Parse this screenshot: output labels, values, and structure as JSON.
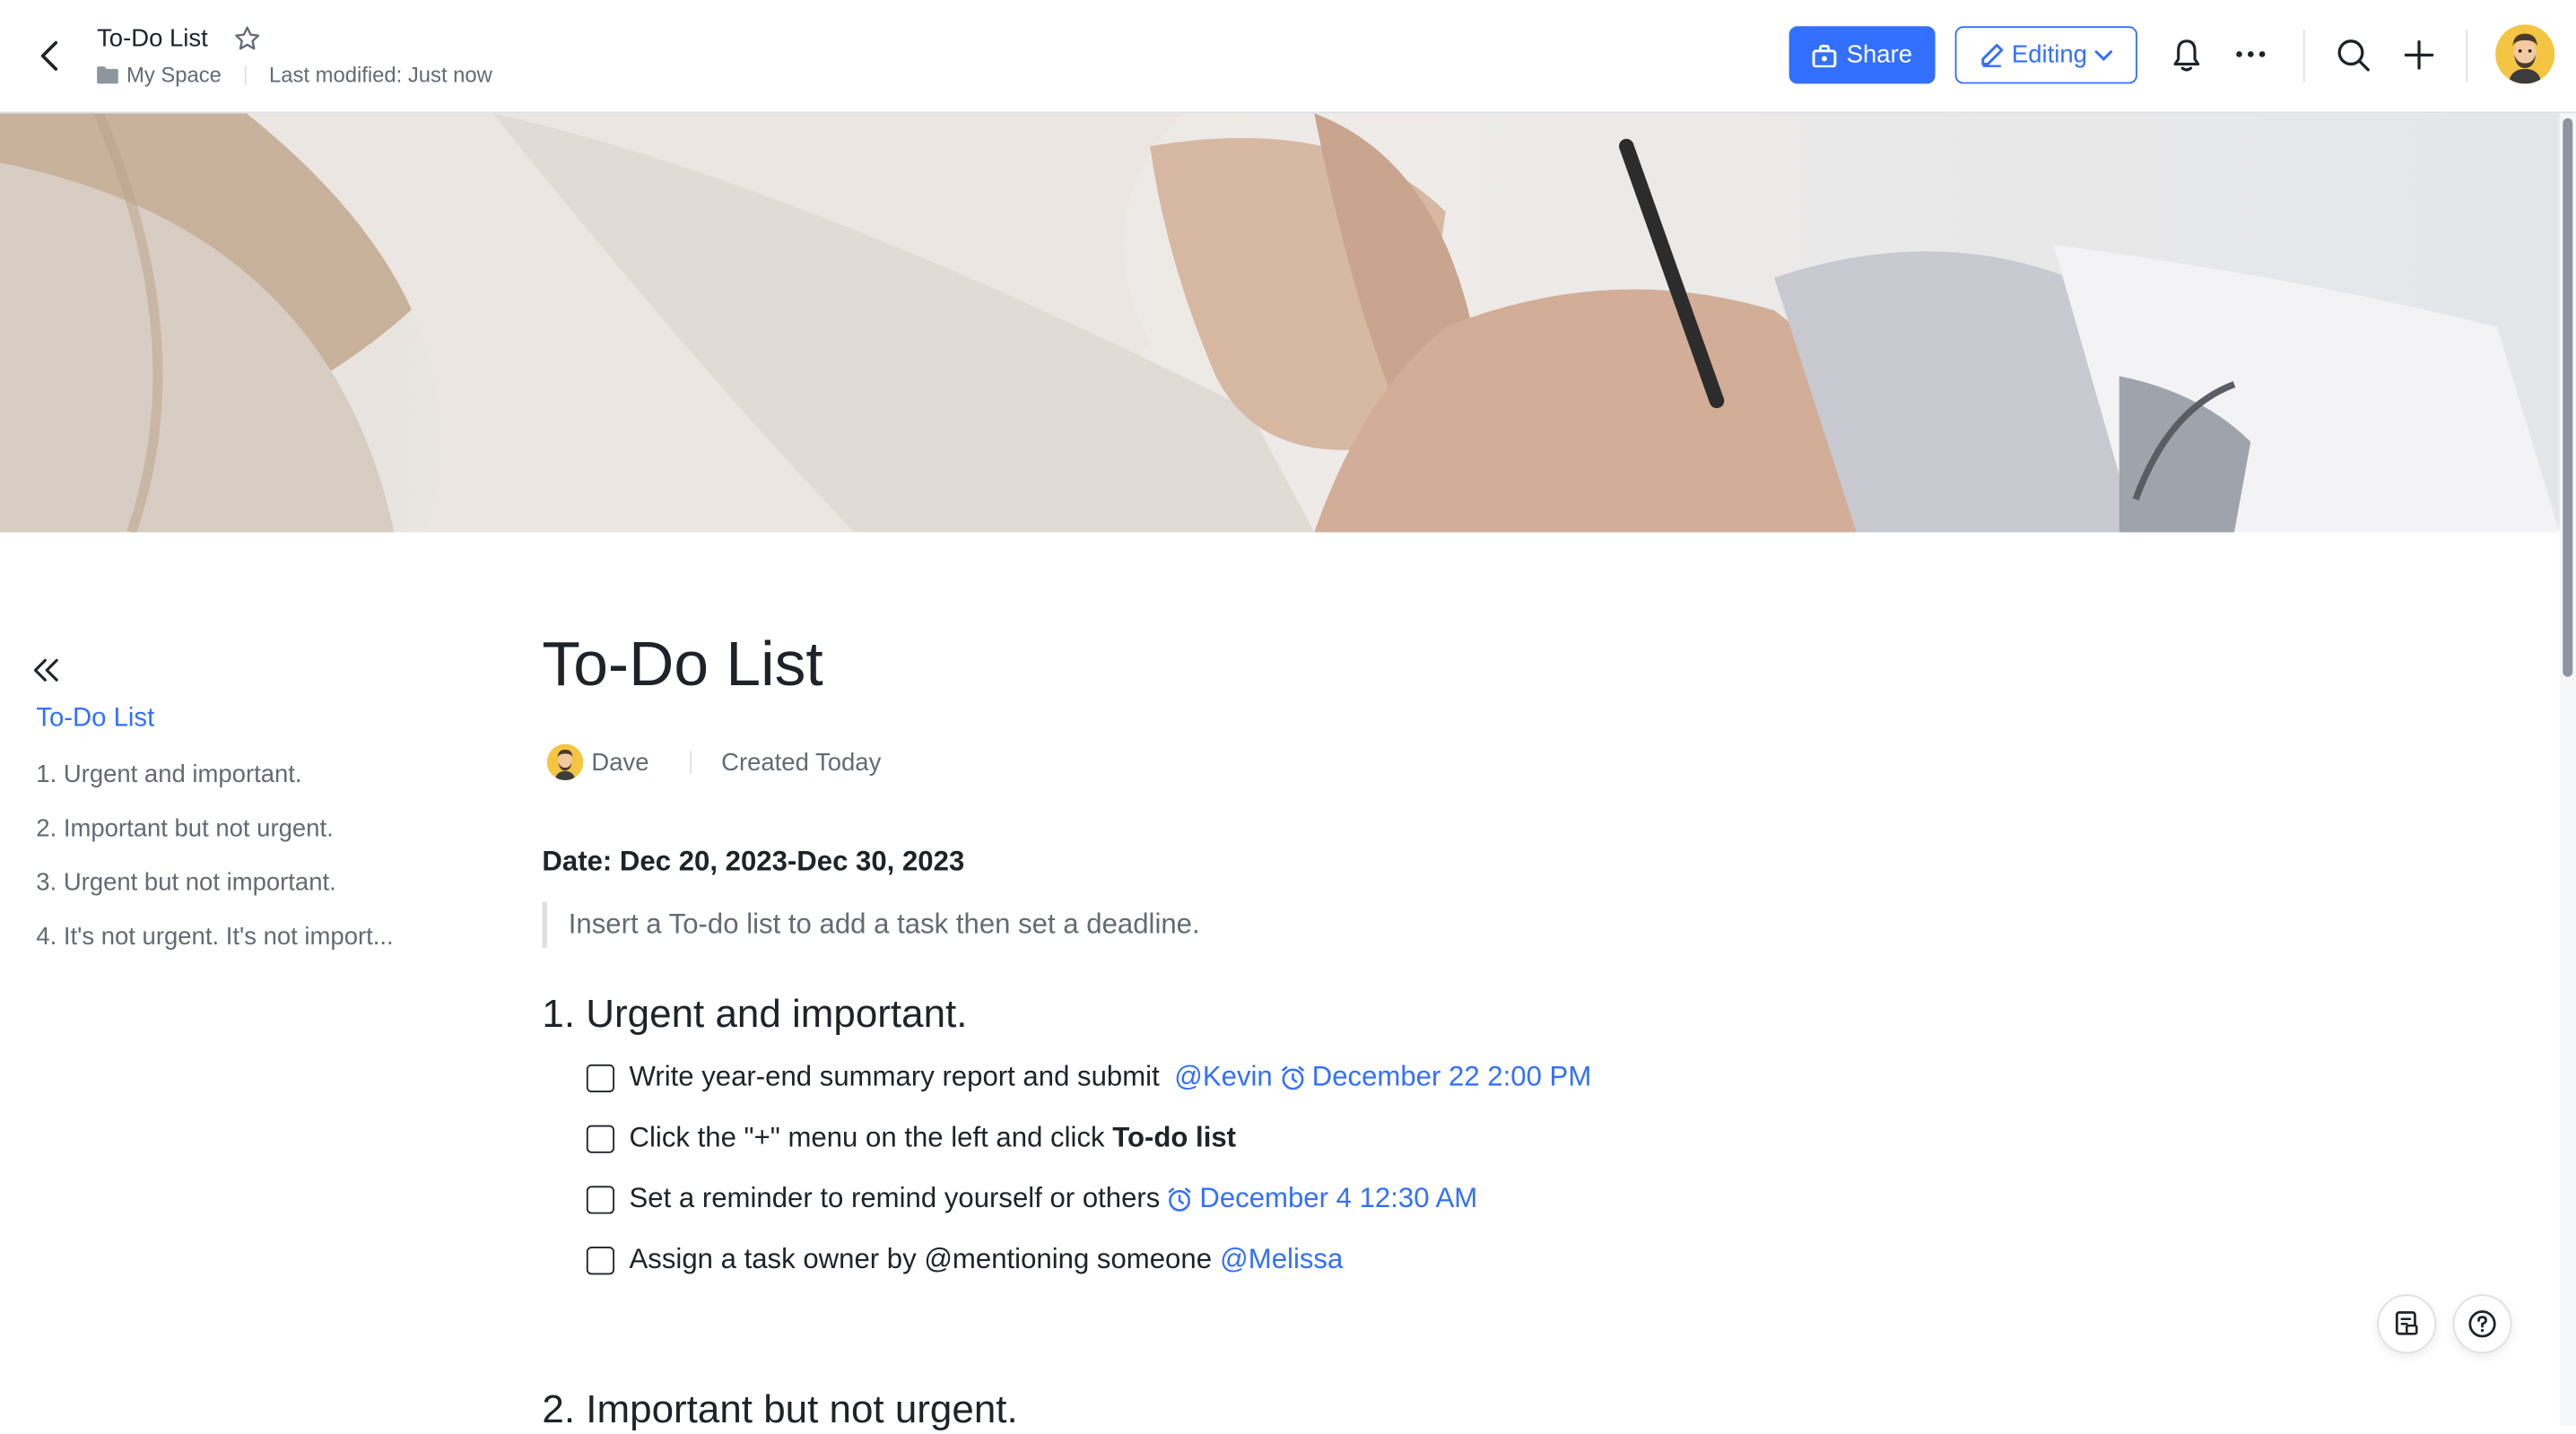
{
  "header": {
    "doc_title": "To-Do List",
    "location": "My Space",
    "last_modified": "Last modified: Just now",
    "share_label": "Share",
    "editing_label": "Editing",
    "accent": "#3370ff"
  },
  "toc": {
    "items": [
      {
        "label": "To-Do List"
      },
      {
        "label": "1. Urgent and important."
      },
      {
        "label": "2. Important but not urgent."
      },
      {
        "label": "3. Urgent but not important."
      },
      {
        "label": "4. It's not urgent. It's not import..."
      }
    ]
  },
  "doc": {
    "title": "To-Do List",
    "author": "Dave",
    "created": "Created Today",
    "date_line": "Date: Dec 20, 2023-Dec 30, 2023",
    "quote": "Insert a To-do list to add a task then set a deadline.",
    "section1": "1. Urgent and important.",
    "section2": "2. Important but not urgent.",
    "todos": [
      {
        "text": "Write year-end summary report and submit",
        "mention": "@Kevin",
        "reminder": "December 22 2:00 PM"
      },
      {
        "text": "Click the \"+\" menu on the left and click ",
        "bold": "To-do list"
      },
      {
        "text": "Set a reminder to remind yourself or others",
        "reminder": "December 4 12:30 AM"
      },
      {
        "text": "Assign a task owner by @mentioning someone",
        "mention": "@Melissa"
      }
    ]
  }
}
